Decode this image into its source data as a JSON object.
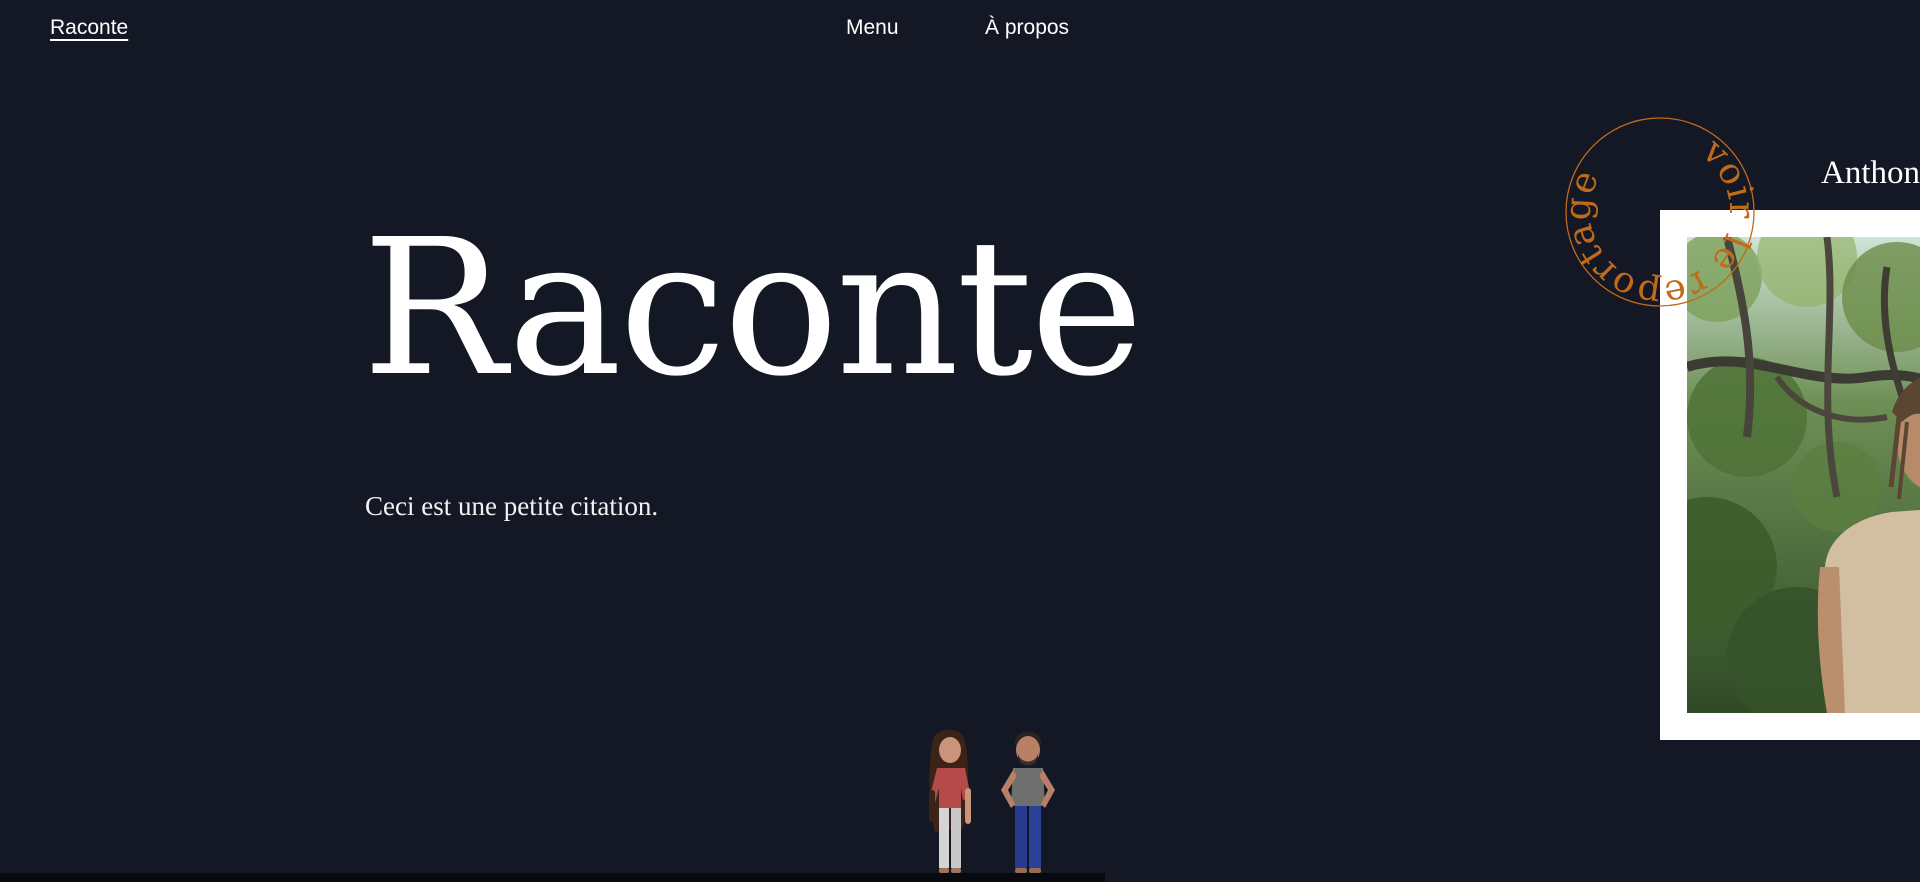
{
  "header": {
    "brand": "Raconte",
    "nav": {
      "menu": "Menu",
      "about": "À propos"
    }
  },
  "hero": {
    "title": "Raconte",
    "quote": "Ceci est une petite citation."
  },
  "feature": {
    "badge_text": "voir le reportage",
    "name": "Anthony"
  },
  "colors": {
    "background": "#131824",
    "text": "#ffffff",
    "accent": "#c06a1a",
    "frame": "#ffffff"
  }
}
